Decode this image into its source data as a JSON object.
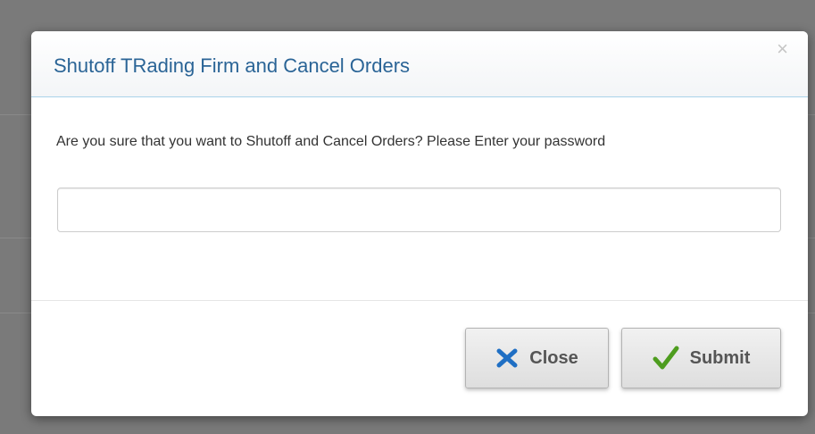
{
  "modal": {
    "title": "Shutoff TRading Firm and Cancel Orders",
    "close_symbol": "×",
    "message": "Are you sure that you want to Shutoff and Cancel Orders? Please Enter your password",
    "password_value": "",
    "buttons": {
      "close_label": "Close",
      "close_icon": "x-icon",
      "submit_label": "Submit",
      "submit_icon": "checkmark-icon"
    }
  },
  "colors": {
    "title": "#2a6496",
    "close_icon": "#1f6fc4",
    "check_icon": "#4e9d1f",
    "backdrop": "#7a7a7a"
  }
}
